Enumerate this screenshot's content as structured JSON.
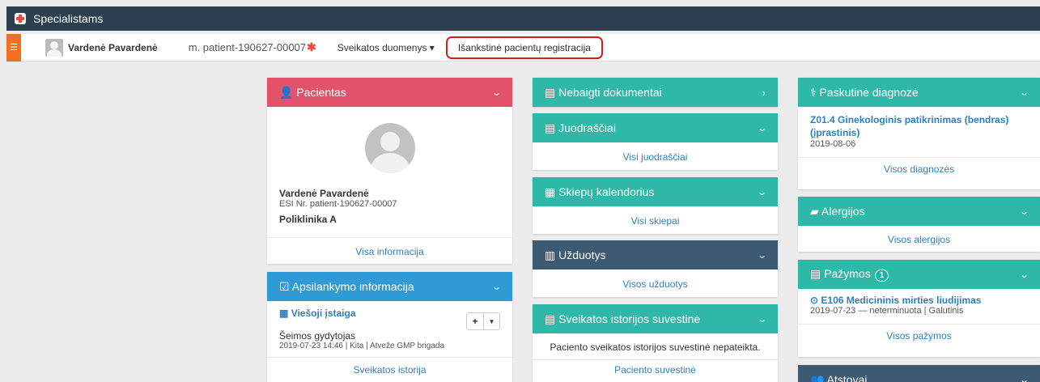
{
  "app": {
    "title": "Specialistams"
  },
  "subbar": {
    "patient_name": "Vardenė Pavardenė",
    "patient_id": "m. patient-190627-00007",
    "star": "✱",
    "health_menu": "Sveikatos duomenys ▾",
    "registration": "Išankstinė pacientų registracija"
  },
  "col1": {
    "patient": {
      "title": "Pacientas",
      "name": "Vardenė Pavardenė",
      "esi": "ESI Nr. patient-190627-00007",
      "clinic": "Poliklinika A",
      "link": "Visa informacija"
    },
    "visit": {
      "title": "Apsilankymo informacija",
      "institution": "Viešoji įstaiga",
      "role": "Šeimos gydytojas",
      "meta": "2019-07-23 14:46  |  Kita  |  Atveže GMP brigada",
      "link": "Sveikatos istorija",
      "add": "+",
      "caret": "▼"
    }
  },
  "col2": {
    "unfinished": {
      "title": "Nebaigti dokumentai"
    },
    "drafts": {
      "title": "Juodraščiai",
      "link": "Visi juodraščiai"
    },
    "vaccines": {
      "title": "Skiepų kalendorius",
      "link": "Visi skiepai"
    },
    "tasks": {
      "title": "Užduotys",
      "link": "Visos užduotys"
    },
    "summary": {
      "title": "Sveikatos istorijos suvestinė",
      "empty": "Paciento sveikatos istorijos suvestinė nepateikta.",
      "link": "Paciento suvestinė"
    }
  },
  "col3": {
    "diagnosis": {
      "title": "Paskutinė diagnozė",
      "item": "Z01.4 Ginekologinis patikrinimas (bendras) (įprastinis)",
      "date": "2019-08-06",
      "link": "Visos diagnozės"
    },
    "allergies": {
      "title": "Alergijos",
      "link": "Visos alergijos"
    },
    "certificates": {
      "title": "Pažymos",
      "badge": "1",
      "item": "E106 Medicininis mirties liudijimas",
      "meta": "2019-07-23 — neterminuota  |  Galutinis",
      "link": "Visos pažymos"
    },
    "representatives": {
      "title": "Atstovai"
    }
  }
}
